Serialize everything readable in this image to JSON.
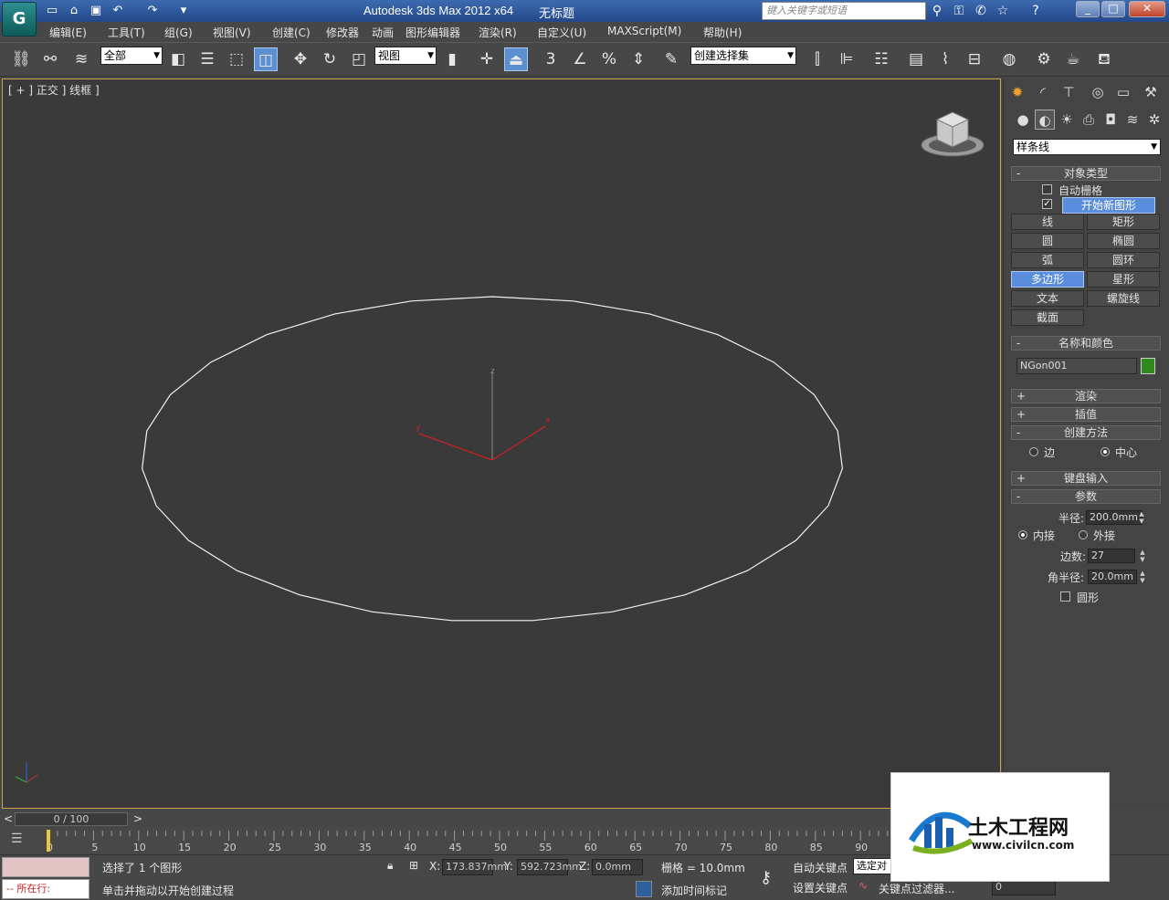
{
  "title_bar": {
    "app_logo": "G",
    "app_title": "Autodesk 3ds Max  2012 x64",
    "document": "无标题",
    "search_placeholder": "键入关键字或短语"
  },
  "menu": [
    "编辑(E)",
    "工具(T)",
    "组(G)",
    "视图(V)",
    "创建(C)",
    "修改器",
    "动画",
    "图形编辑器",
    "渲染(R)",
    "自定义(U)",
    "MAXScript(M)",
    "帮助(H)"
  ],
  "toolbar": {
    "selection_filter": "全部",
    "reference_coord": "视图",
    "named_selection": "创建选择集",
    "snap_label": "3",
    "percent_label": "%"
  },
  "viewport": {
    "label": "[ + ] 正交 ] 线框 ]",
    "axis_x": "x",
    "axis_y": "y",
    "axis_z": "z"
  },
  "command_panel": {
    "category": "样条线",
    "object_type_title": "对象类型",
    "auto_grid": "自动栅格",
    "start_new_shape": "开始新图形",
    "buttons": [
      "线",
      "矩形",
      "圆",
      "椭圆",
      "弧",
      "圆环",
      "多边形",
      "星形",
      "文本",
      "螺旋线",
      "截面"
    ],
    "active_button": "多边形",
    "name_color_title": "名称和颜色",
    "object_name": "NGon001",
    "object_color": "#2e8a1e",
    "rendering": "渲染",
    "interpolation": "插值",
    "creation_method": "创建方法",
    "edge": "边",
    "center": "中心",
    "keyboard_entry": "键盘输入",
    "parameters": "参数",
    "radius_label": "半径:",
    "radius_value": "200.0mm",
    "inscribed": "内接",
    "circumscribed": "外接",
    "sides_label": "边数:",
    "sides_value": "27",
    "corner_radius_label": "角半径:",
    "corner_radius_value": "20.0mm",
    "circular": "圆形"
  },
  "timeline": {
    "frame_display": "0 / 100",
    "ticks": [
      "0",
      "5",
      "10",
      "15",
      "20",
      "25",
      "30",
      "35",
      "40",
      "45",
      "50",
      "55",
      "60",
      "65",
      "70",
      "75",
      "80",
      "85",
      "90"
    ]
  },
  "status": {
    "listener": "-- 所在行:",
    "selection": "选择了 1 个图形",
    "prompt": "单击并拖动以开始创建过程",
    "x_label": "X:",
    "x_value": "173.837mm",
    "y_label": "Y:",
    "y_value": "592.723mm",
    "z_label": "Z:",
    "z_value": "0.0mm",
    "grid": "栅格 = 10.0mm",
    "auto_key": "自动关键点",
    "set_key": "设置关键点",
    "selected_obj": "选定对",
    "key_filters": "关键点过滤器...",
    "add_time_tag": "添加时间标记",
    "frame_field": "0"
  },
  "watermark": {
    "name": "土木工程网",
    "url": "www.civilcn.com"
  }
}
